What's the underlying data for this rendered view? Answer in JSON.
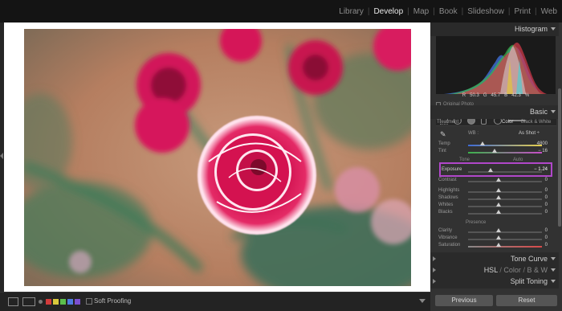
{
  "modules": [
    "Library",
    "Develop",
    "Map",
    "Book",
    "Slideshow",
    "Print",
    "Web"
  ],
  "active_module": "Develop",
  "toolbar": {
    "soft_proofing_label": "Soft Proofing",
    "flag_colors": [
      "#d23b3b",
      "#d8c83c",
      "#5bbf4c",
      "#4d7be0",
      "#7b4fd0"
    ]
  },
  "histogram_panel": {
    "title": "Histogram",
    "readout": {
      "r_label": "R",
      "r": "50.3",
      "g_label": "G",
      "g": "45.7",
      "b_label": "B",
      "b": "42.3",
      "unit": "%"
    },
    "original_photo": "Original Photo"
  },
  "basic_panel": {
    "title": "Basic",
    "treatment_label": "Treatment :",
    "treatment_color": "Color",
    "treatment_bw": "Black & White",
    "wb_label": "WB :",
    "wb_value": "As Shot ÷",
    "tone_label": "Tone",
    "auto_label": "Auto",
    "presence_label": "Presence",
    "sliders": [
      {
        "name": "Temp",
        "value": "4800",
        "pos": 0.58
      },
      {
        "name": "Tint",
        "value": "− 16",
        "pos": 0.47
      },
      {
        "name": "Exposure",
        "value": "− 1.24",
        "pos": 0.38
      },
      {
        "name": "Contrast",
        "value": "0",
        "pos": 0.5
      },
      {
        "name": "Highlights",
        "value": "0",
        "pos": 0.5
      },
      {
        "name": "Shadows",
        "value": "0",
        "pos": 0.5
      },
      {
        "name": "Whites",
        "value": "0",
        "pos": 0.5
      },
      {
        "name": "Blacks",
        "value": "0",
        "pos": 0.5
      },
      {
        "name": "Clarity",
        "value": "0",
        "pos": 0.5
      },
      {
        "name": "Vibrance",
        "value": "0",
        "pos": 0.5
      },
      {
        "name": "Saturation",
        "value": "0",
        "pos": 0.5
      }
    ]
  },
  "tone_curve": {
    "title": "Tone Curve"
  },
  "hsl": {
    "hsl": "HSL",
    "sep": "/",
    "color": "Color",
    "bw": "B & W"
  },
  "split_toning": {
    "title": "Split Toning"
  },
  "buttons": {
    "previous": "Previous",
    "reset": "Reset"
  },
  "colors": {
    "highlight": "#b047c9",
    "panel_bg": "#323232",
    "header_bg": "#141414"
  }
}
